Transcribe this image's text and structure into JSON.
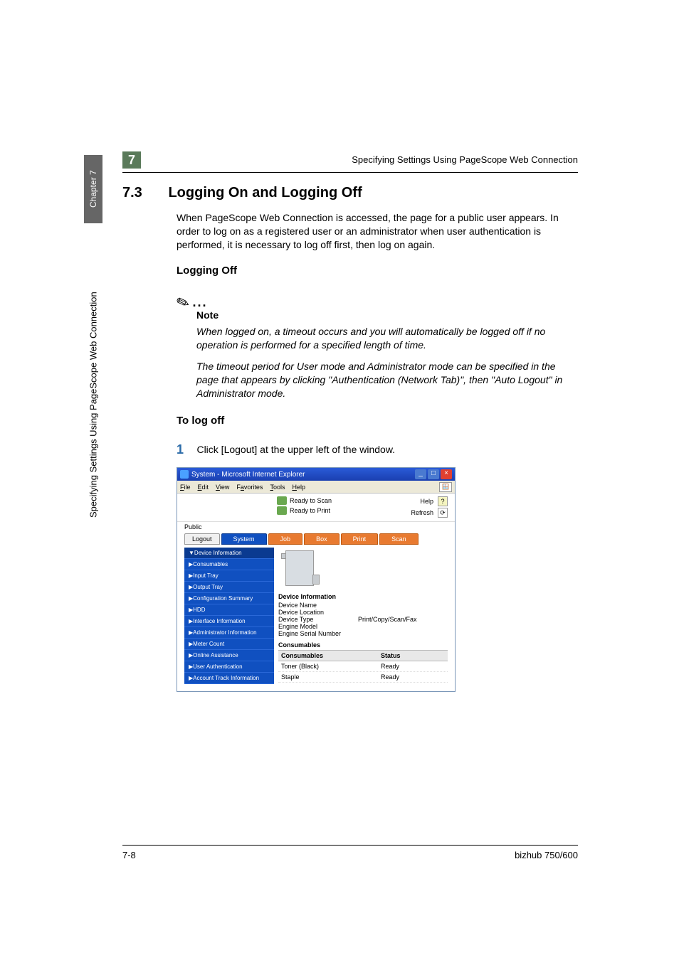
{
  "side": {
    "chapter": "Chapter 7",
    "long_label": "Specifying Settings Using PageScope Web Connection"
  },
  "header": {
    "pagenum": "7",
    "running_title": "Specifying Settings Using PageScope Web Connection"
  },
  "section": {
    "number": "7.3",
    "title": "Logging On and Logging Off",
    "intro": "When PageScope Web Connection is accessed, the page for a public user appears. In order to log on as a registered user or an administrator when user authentication is performed, it is necessary to log off first, then log on again."
  },
  "subheading_logging_off": "Logging Off",
  "note": {
    "label": "Note",
    "para1": "When logged on, a timeout occurs and you will automatically be logged off if no operation is performed for a specified length of time.",
    "para2": "The timeout period for User mode and Administrator mode can be specified in the page that appears by clicking \"Authentication (Network Tab)\", then \"Auto Logout\" in Administrator mode."
  },
  "subheading_to_log_off": "To log off",
  "step1": {
    "num": "1",
    "text": "Click [Logout] at the upper left of the window."
  },
  "ss": {
    "title": "System - Microsoft Internet Explorer",
    "menu": {
      "file": "File",
      "edit": "Edit",
      "view": "View",
      "favorites": "Favorites",
      "tools": "Tools",
      "help": "Help"
    },
    "status": {
      "scan": "Ready to Scan",
      "print": "Ready to Print"
    },
    "help": "Help",
    "refresh": "Refresh",
    "user": "Public",
    "tabs": {
      "logout": "Logout",
      "system": "System",
      "job": "Job",
      "box": "Box",
      "print": "Print",
      "scan": "Scan"
    },
    "nav": {
      "devinfo": "▼Device Information",
      "consumables": "▶Consumables",
      "inputtray": "▶Input Tray",
      "outputtray": "▶Output Tray",
      "config": "▶Configuration Summary",
      "hdd": "▶HDD",
      "iface": "▶Interface Information",
      "admin": "▶Administrator Information",
      "meter": "▶Meter Count",
      "online": "▶Online Assistance",
      "userauth": "▶User Authentication",
      "account": "▶Account Track Information"
    },
    "devinfo": {
      "heading": "Device Information",
      "name": "Device Name",
      "location": "Device Location",
      "type": "Device Type",
      "type_val": "Print/Copy/Scan/Fax",
      "model": "Engine Model",
      "serial": "Engine Serial Number"
    },
    "cons": {
      "heading": "Consumables",
      "col1": "Consumables",
      "col2": "Status",
      "row1": {
        "name": "Toner (Black)",
        "status": "Ready"
      },
      "row2": {
        "name": "Staple",
        "status": "Ready"
      }
    }
  },
  "footer": {
    "left": "7-8",
    "right": "bizhub 750/600"
  }
}
